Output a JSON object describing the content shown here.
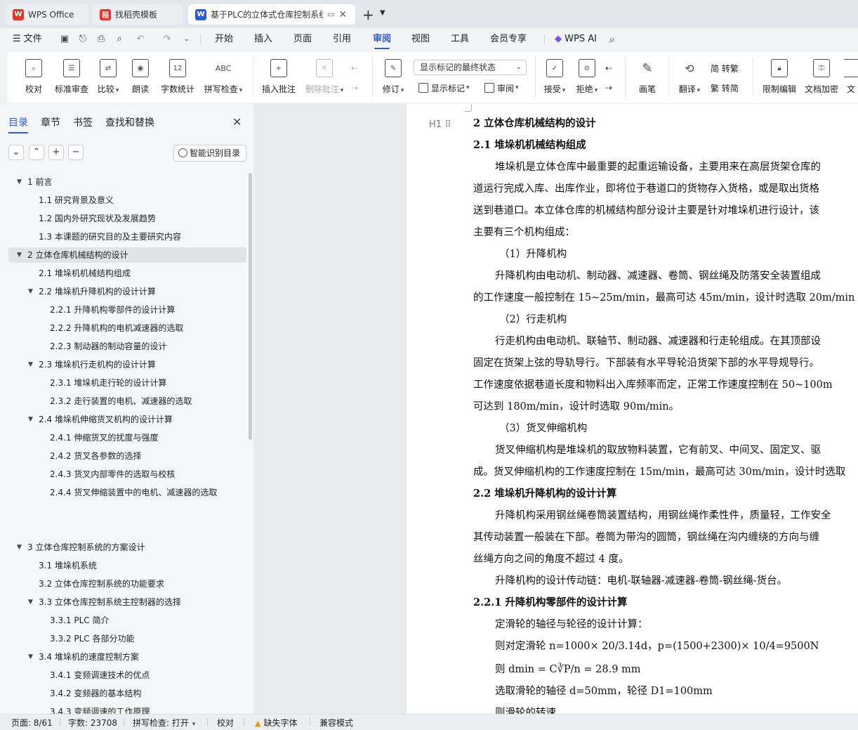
{
  "tabs": [
    {
      "label": "WPS Office",
      "logo": "W",
      "logo_color": "#e8342b"
    },
    {
      "label": "找稻壳模板",
      "logo": "稻",
      "logo_color": "#e8342b"
    },
    {
      "label": "基于PLC的立体式仓库控制系统",
      "logo": "W",
      "logo_color": "#2b5cd6"
    }
  ],
  "menu": {
    "file": "文件",
    "items": [
      "开始",
      "插入",
      "页面",
      "引用",
      "审阅",
      "视图",
      "工具",
      "会员专享"
    ],
    "active": "审阅",
    "wps_ai": "WPS AI"
  },
  "ribbon": {
    "proofread": "校对",
    "standard_review": "标准审查",
    "compare": "比较",
    "read_aloud": "朗读",
    "word_count": "字数统计",
    "spell_check": "拼写检查",
    "insert_comment": "插入批注",
    "delete_comment": "删除批注",
    "track_changes": "修订",
    "markup_state": "显示标记的最终状态",
    "show_markup": "显示标记",
    "review": "审阅",
    "accept": "接受",
    "reject": "拒绝",
    "pen": "画笔",
    "translate": "翻译",
    "to_traditional": "简 转繁",
    "to_simplified": "繁 转简",
    "restrict_edit": "限制编辑",
    "doc_encrypt": "文档加密",
    "doc_cut": "文",
    "word_count_icon_text": "12",
    "spell_icon_text": "ABC"
  },
  "nav": {
    "tabs": [
      "目录",
      "章节",
      "书签",
      "查找和替换"
    ],
    "smart_toc": "智能识别目录",
    "toc": [
      {
        "label": "1  前言",
        "level": 1,
        "twisty": "▼"
      },
      {
        "label": "1.1 研究背景及意义",
        "level": 2,
        "twisty": ""
      },
      {
        "label": "1.2 国内外研究现状及发展趋势",
        "level": 2,
        "twisty": ""
      },
      {
        "label": "1.3 本课题的研究目的及主要研究内容",
        "level": 2,
        "twisty": ""
      },
      {
        "label": "2  立体仓库机械结构的设计",
        "level": 1,
        "twisty": "▼",
        "selected": true
      },
      {
        "label": "2.1 堆垛机机械结构组成",
        "level": 2,
        "twisty": ""
      },
      {
        "label": "2.2 堆垛机升降机构的设计计算",
        "level": 2,
        "twisty": "▼"
      },
      {
        "label": "2.2.1 升降机构零部件的设计计算",
        "level": 3,
        "twisty": ""
      },
      {
        "label": "2.2.2 升降机构的电机减速器的选取",
        "level": 3,
        "twisty": ""
      },
      {
        "label": "2.2.3 制动器的制动容量的设计",
        "level": 3,
        "twisty": ""
      },
      {
        "label": "2.3 堆垛机行走机构的设计计算",
        "level": 2,
        "twisty": "▼"
      },
      {
        "label": "2.3.1 堆垛机走行轮的设计计算",
        "level": 3,
        "twisty": ""
      },
      {
        "label": "2.3.2 走行装置的电机、减速器的选取",
        "level": 3,
        "twisty": ""
      },
      {
        "label": "2.4 堆垛机伸缩货叉机构的设计计算",
        "level": 2,
        "twisty": "▼"
      },
      {
        "label": "2.4.1 伸缩货叉的扰度与强度",
        "level": 3,
        "twisty": ""
      },
      {
        "label": "2.4.2 货叉各参数的选择",
        "level": 3,
        "twisty": ""
      },
      {
        "label": "2.4.3 货叉内部零件的选取与校核",
        "level": 3,
        "twisty": ""
      },
      {
        "label": "2.4.4 货叉伸缩装置中的电机、减速器的选取",
        "level": 3,
        "twisty": ""
      },
      {
        "label": "3  立体仓库控制系统的方案设计",
        "level": 1,
        "twisty": "▼"
      },
      {
        "label": "3.1  堆垛机系统",
        "level": 2,
        "twisty": ""
      },
      {
        "label": "3.2 立体仓库控制系统的功能要求",
        "level": 2,
        "twisty": ""
      },
      {
        "label": "3.3 立体仓库控制系统主控制器的选择",
        "level": 2,
        "twisty": "▼"
      },
      {
        "label": "3.3.1 PLC 简介",
        "level": 3,
        "twisty": ""
      },
      {
        "label": "3.3.2 PLC 各部分功能",
        "level": 3,
        "twisty": ""
      },
      {
        "label": "3.4 堆垛机的速度控制方案",
        "level": 2,
        "twisty": "▼"
      },
      {
        "label": "3.4.1 变频调速技术的优点",
        "level": 3,
        "twisty": ""
      },
      {
        "label": "3.4.2 变频器的基本结构",
        "level": 3,
        "twisty": ""
      },
      {
        "label": "3.4.3 变频调速的工作原理",
        "level": 3,
        "twisty": ""
      }
    ]
  },
  "document": {
    "heading_marker": "H1",
    "lines": [
      {
        "text": "2  立体仓库机械结构的设计",
        "style": "h"
      },
      {
        "text": "2.1 堆垛机机械结构组成",
        "style": "h"
      },
      {
        "text": "堆垛机是立体仓库中最重要的起重运输设备，主要用来在高层货架仓库的",
        "style": "ind"
      },
      {
        "text": "道运行完成入库、出库作业，即将位于巷道口的货物存入货格，或是取出货格",
        "style": ""
      },
      {
        "text": "送到巷道口。本立体仓库的机械结构部分设计主要是针对堆垛机进行设计，该",
        "style": ""
      },
      {
        "text": "主要有三个机构组成：",
        "style": ""
      },
      {
        "text": "（1）升降机构",
        "style": "ind2"
      },
      {
        "text": "升降机构由电动机、制动器、减速器、卷筒、钢丝绳及防落安全装置组成",
        "style": "ind"
      },
      {
        "text": "的工作速度一般控制在 15~25m/min，最高可达 45m/min，设计时选取 20m/min",
        "style": ""
      },
      {
        "text": "（2）行走机构",
        "style": "ind2"
      },
      {
        "text": "行走机构由电动机、联轴节、制动器、减速器和行走轮组成。在其顶部设",
        "style": "ind"
      },
      {
        "text": "固定在货架上弦的导轨导行。下部装有水平导轮沿货架下部的水平导规导行。",
        "style": ""
      },
      {
        "text": "工作速度依据巷道长度和物料出入库频率而定，正常工作速度控制在 50~100m",
        "style": ""
      },
      {
        "text": "可达到 180m/min，设计时选取 90m/min。",
        "style": ""
      },
      {
        "text": "（3）货叉伸缩机构",
        "style": "ind2"
      },
      {
        "text": "货叉伸缩机构是堆垛机的取放物料装置，它有前叉、中间叉、固定叉、驱",
        "style": "ind"
      },
      {
        "text": "成。货叉伸缩机构的工作速度控制在 15m/min，最高可达 30m/min，设计时选取",
        "style": ""
      },
      {
        "text": "2.2 堆垛机升降机构的设计计算",
        "style": "h"
      },
      {
        "text": "升降机构采用钢丝绳卷筒装置结构，用钢丝绳作柔性件，质量轻，工作安全",
        "style": "ind"
      },
      {
        "text": "其传动装置一般装在下部。卷筒为带沟的圆筒，钢丝绳在沟内缠绕的方向与缠",
        "style": ""
      },
      {
        "text": "丝绳方向之间的角度不超过 4 度。",
        "style": ""
      },
      {
        "text": "升降机构的设计传动链：电机-联轴器-减速器-卷筒-钢丝绳-货台。",
        "style": "ind"
      },
      {
        "text": "2.2.1 升降机构零部件的设计计算",
        "style": "h"
      },
      {
        "text": "定滑轮的轴径与轮径的设计计算：",
        "style": "ind"
      },
      {
        "text": "则对定滑轮 n=1000× 20/3.14d，p=(1500+2300)× 10/4=9500N",
        "style": "ind"
      },
      {
        "text": "则 dmin = C∛P/n = 28.9   mm",
        "style": "ind"
      },
      {
        "text": "选取滑轮的轴径 d=50mm，轮径 D1=100mm",
        "style": "ind"
      },
      {
        "text": "则滑轮的转速",
        "style": "ind"
      }
    ]
  },
  "status": {
    "page": "页面: 8/61",
    "words": "字数: 23708",
    "spell": "拼写检查: 打开",
    "proofread": "校对",
    "missing_fonts": "缺失字体",
    "compat": "兼容模式"
  }
}
